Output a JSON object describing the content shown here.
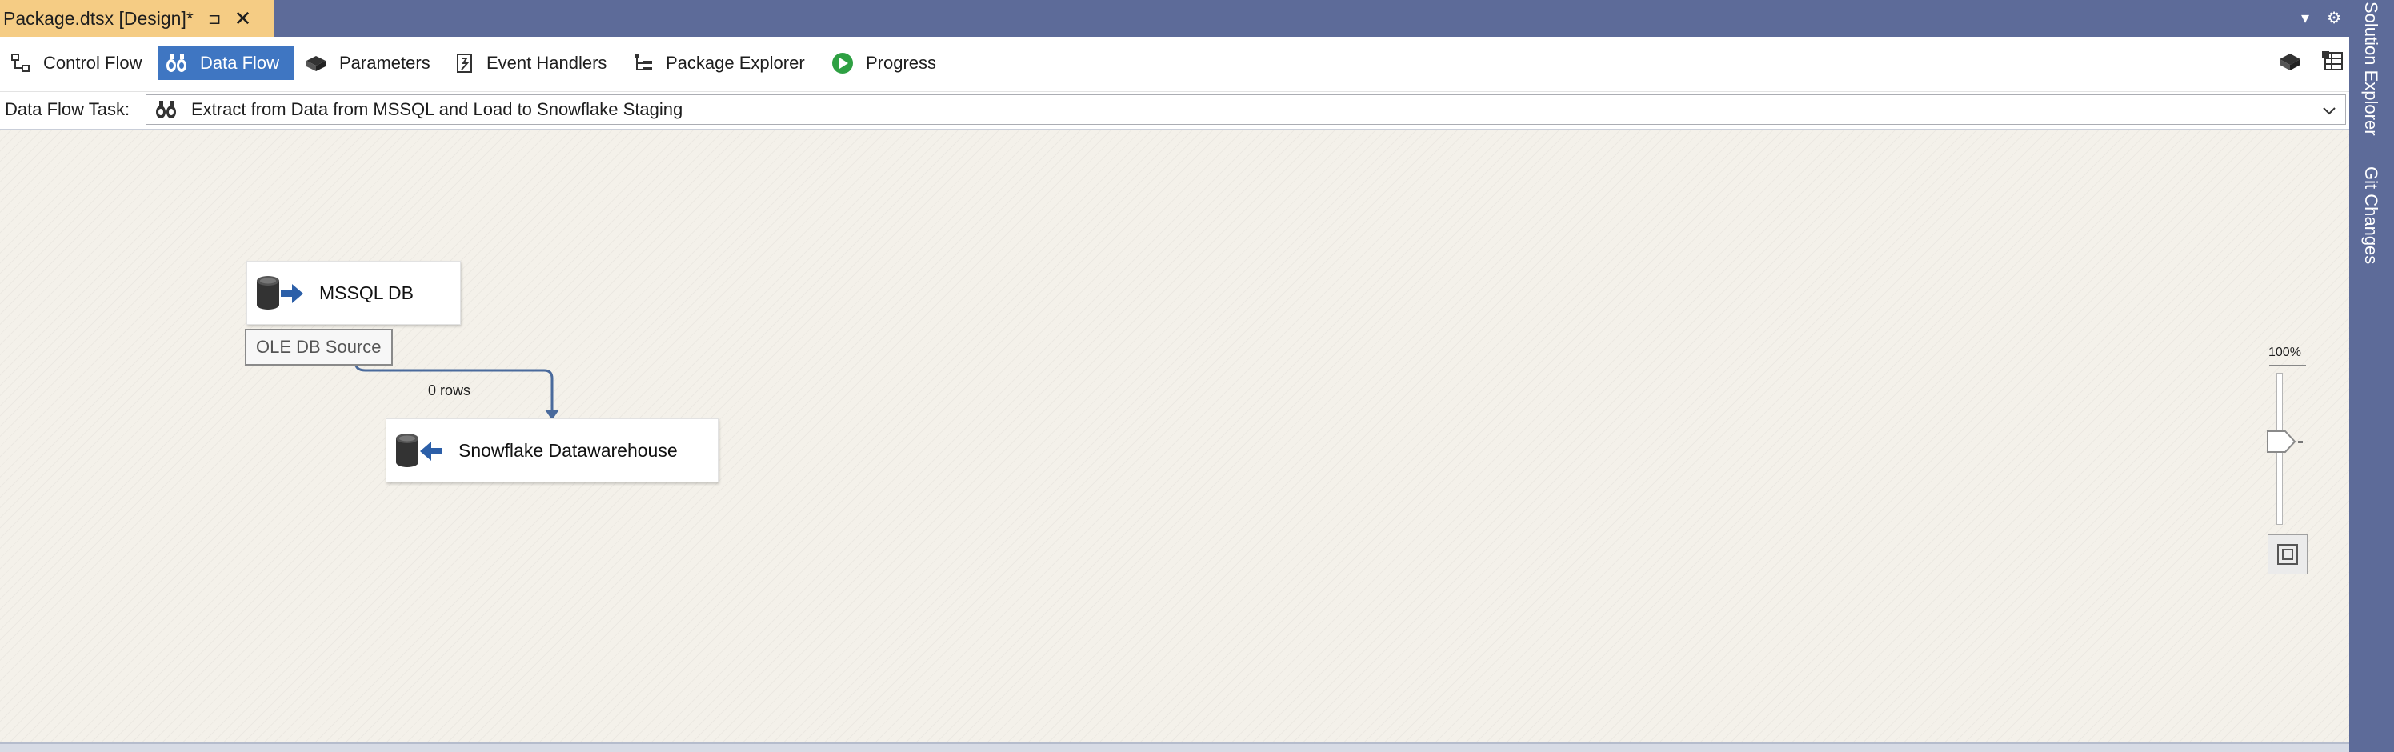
{
  "document_tab": {
    "title": "Package.dtsx [Design]*",
    "pin_glyph": "⊐",
    "close_glyph": "✕"
  },
  "tabstrip_right": {
    "dropdown_glyph": "▾",
    "gear_glyph": "⚙"
  },
  "designer_tabs": [
    {
      "label": "Control Flow",
      "icon": "control-flow-icon",
      "active": false
    },
    {
      "label": "Data Flow",
      "icon": "data-flow-icon",
      "active": true
    },
    {
      "label": "Parameters",
      "icon": "parameters-icon",
      "active": false
    },
    {
      "label": "Event Handlers",
      "icon": "event-handlers-icon",
      "active": false
    },
    {
      "label": "Package Explorer",
      "icon": "package-explorer-icon",
      "active": false
    },
    {
      "label": "Progress",
      "icon": "progress-icon",
      "active": false
    }
  ],
  "task_selector": {
    "label": "Data Flow Task:",
    "value": "Extract from Data from MSSQL and Load to Snowflake Staging"
  },
  "canvas": {
    "components": [
      {
        "name": "MSSQL DB",
        "icon": "ole-db-source-icon",
        "type_tooltip": "OLE DB Source"
      },
      {
        "name": "Snowflake Datawarehouse",
        "icon": "ole-db-destination-icon"
      }
    ],
    "path_label": "0 rows"
  },
  "zoom": {
    "label": "100%",
    "level_percent": 100
  },
  "side_panel": {
    "tabs": [
      "Solution Explorer",
      "Git Changes"
    ]
  },
  "colors": {
    "accent_blue": "#3f76c2",
    "tab_strip": "#5d6b99",
    "active_document_tab": "#f5cc84",
    "canvas_background": "#f4f1ea",
    "path_line": "#4a6a9c"
  }
}
